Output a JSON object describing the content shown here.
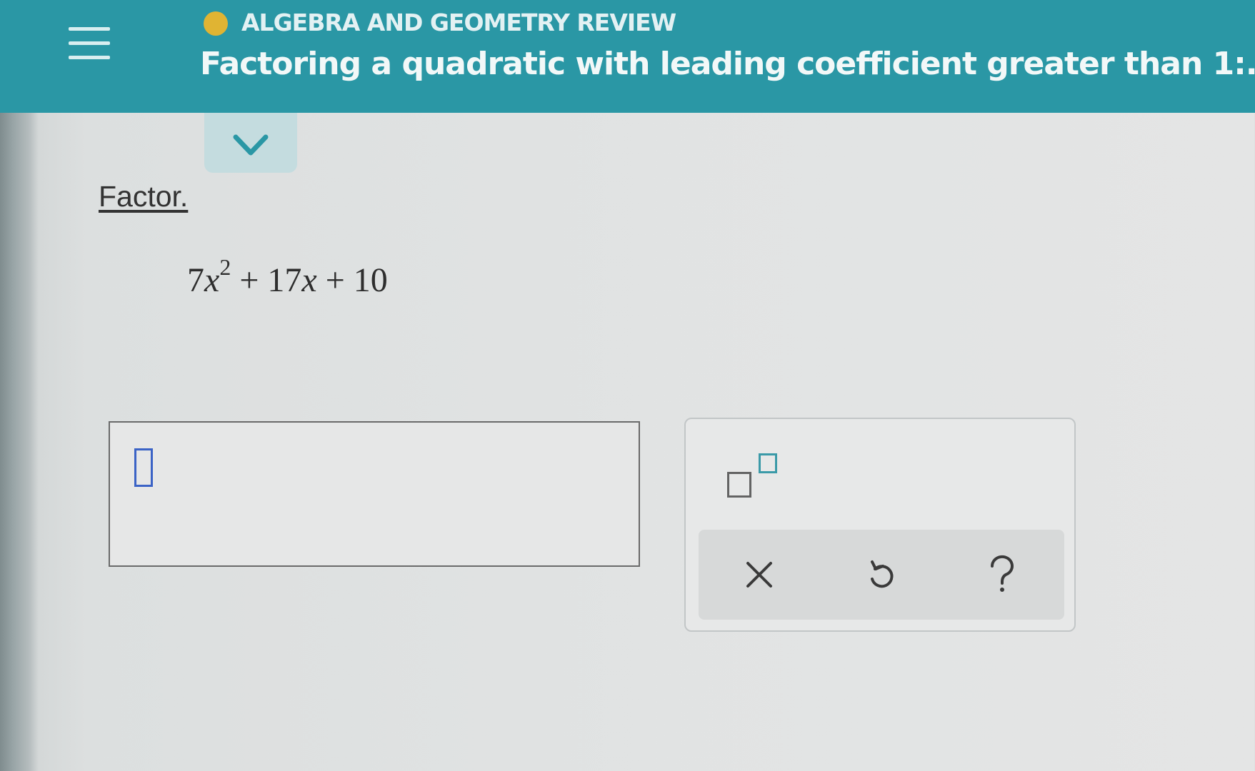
{
  "header": {
    "topic": "ALGEBRA AND GEOMETRY REVIEW",
    "title": "Factoring a quadratic with leading coefficient greater than 1:...",
    "status_color": "#e0b433",
    "background_color": "#2a97a5"
  },
  "icons": {
    "menu": "hamburger-menu-icon",
    "expand": "chevron-down-icon",
    "exponent": "exponent-template-icon",
    "clear": "close-x-icon",
    "undo": "undo-arrow-icon",
    "help": "question-mark-icon"
  },
  "problem": {
    "instruction": "Factor.",
    "coefficient": "7",
    "variable": "x",
    "exponent": "2",
    "middle": " + 17",
    "variable2": "x",
    "constant": " + 10"
  },
  "answer": {
    "value": ""
  },
  "toolbar": {
    "clear_symbol": "×",
    "help_symbol": "?"
  }
}
